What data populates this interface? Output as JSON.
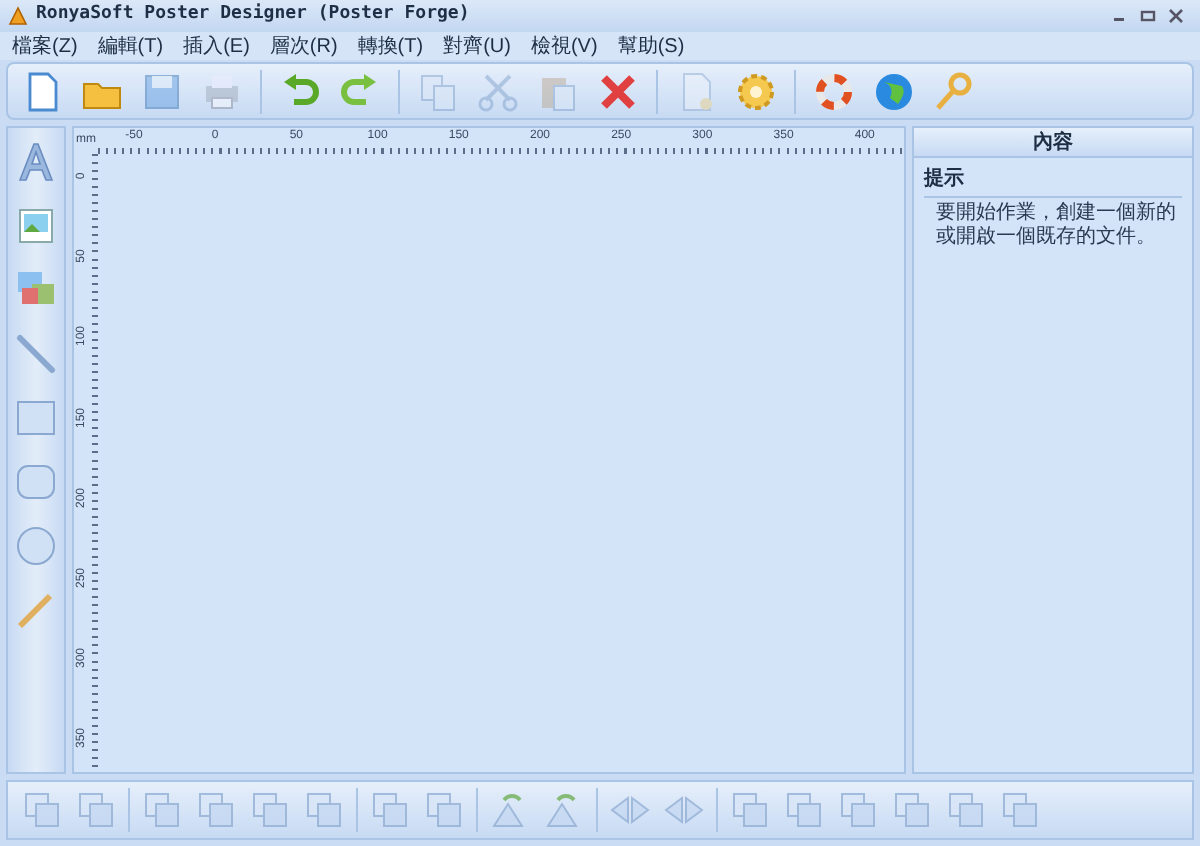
{
  "window": {
    "title": "RonyaSoft Poster Designer (Poster Forge)"
  },
  "menu": [
    "檔案(Z)",
    "編輯(T)",
    "插入(E)",
    "層次(R)",
    "轉換(T)",
    "對齊(U)",
    "檢視(V)",
    "幫助(S)"
  ],
  "toolbar": [
    {
      "kind": "new",
      "disabled": false
    },
    {
      "kind": "open",
      "disabled": false
    },
    {
      "kind": "save",
      "disabled": true
    },
    {
      "kind": "print",
      "disabled": true
    },
    {
      "kind": "sep"
    },
    {
      "kind": "undo",
      "disabled": false
    },
    {
      "kind": "redo",
      "disabled": false
    },
    {
      "kind": "sep"
    },
    {
      "kind": "copy",
      "disabled": true
    },
    {
      "kind": "cut",
      "disabled": true
    },
    {
      "kind": "paste",
      "disabled": true
    },
    {
      "kind": "delete",
      "disabled": false
    },
    {
      "kind": "sep"
    },
    {
      "kind": "page",
      "disabled": true
    },
    {
      "kind": "gear",
      "disabled": false
    },
    {
      "kind": "sep"
    },
    {
      "kind": "lifebuoy",
      "disabled": false
    },
    {
      "kind": "globe",
      "disabled": false
    },
    {
      "kind": "key",
      "disabled": false
    }
  ],
  "ruler": {
    "unit": "mm",
    "x_labels": [
      "-50",
      "0",
      "50",
      "100",
      "150",
      "200",
      "250",
      "300",
      "350",
      "400"
    ],
    "y_labels": [
      "0",
      "50",
      "100",
      "150",
      "200",
      "250",
      "300",
      "350"
    ]
  },
  "panel": {
    "title": "內容",
    "section": "提示",
    "text": "要開始作業，創建一個新的或開啟一個既存的文件。"
  }
}
